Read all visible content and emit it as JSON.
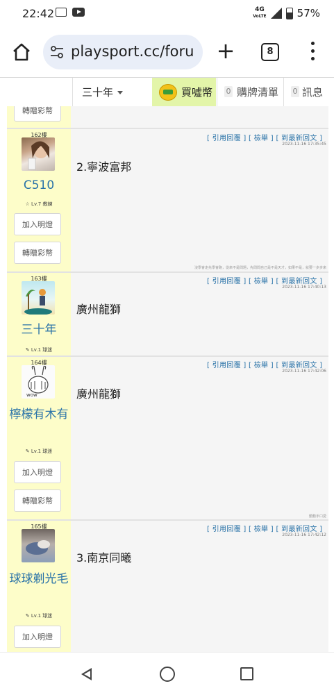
{
  "status": {
    "time": "22:42",
    "network": "4G",
    "volte": "VoLTE",
    "battery": "57%"
  },
  "browser": {
    "url": "playsport.cc/foru",
    "tab_count": "8"
  },
  "site_nav": {
    "user_menu": "三十年",
    "buy_coins": "買噓幣",
    "purchase_list_count": "0",
    "purchase_list": "購牌清單",
    "messages_count": "0",
    "messages": "訊息"
  },
  "top_partial": {
    "gift_button": "轉贈彩幣"
  },
  "posts": [
    {
      "floor": "162樓",
      "username": "C510",
      "level": "☆ Lv.7 教練",
      "follow_button": "加入明燈",
      "gift_button": "轉贈彩幣",
      "actions": "[ 引用回覆 ]  [ 檢舉 ]  [ 到最新回文 ]",
      "timestamp": "2023-11-16 17:35:45",
      "text": "2.寧波富邦",
      "signature": "沒學會走先學會跑，從來不是問題，先問問自己是不是天才，如果不是，就要一步步來"
    },
    {
      "floor": "163樓",
      "username": "三十年",
      "level": "✎ Lv.1 球迷",
      "actions": "[ 引用回覆 ]  [ 檢舉 ]  [ 到最新回文 ]",
      "timestamp": "2023-11-16 17:40:13",
      "text": "廣州龍獅"
    },
    {
      "floor": "164樓",
      "username": "檸檬有木有",
      "level": "✎ Lv.1 球迷",
      "follow_button": "加入明燈",
      "gift_button": "轉贈彩幣",
      "actions": "[ 引用回覆 ]  [ 檢舉 ]  [ 到最新回文 ]",
      "timestamp": "2023-11-16 17:42:06",
      "text": "廣州龍獅",
      "signature": "動動手口愛"
    },
    {
      "floor": "165樓",
      "username": "球球剃光毛",
      "level": "✎ Lv.1 球迷",
      "follow_button": "加入明燈",
      "actions": "[ 引用回覆 ]  [ 檢舉 ]  [ 到最新回文 ]",
      "timestamp": "2023-11-16 17:42:12",
      "text": "3.南京同曦"
    }
  ]
}
